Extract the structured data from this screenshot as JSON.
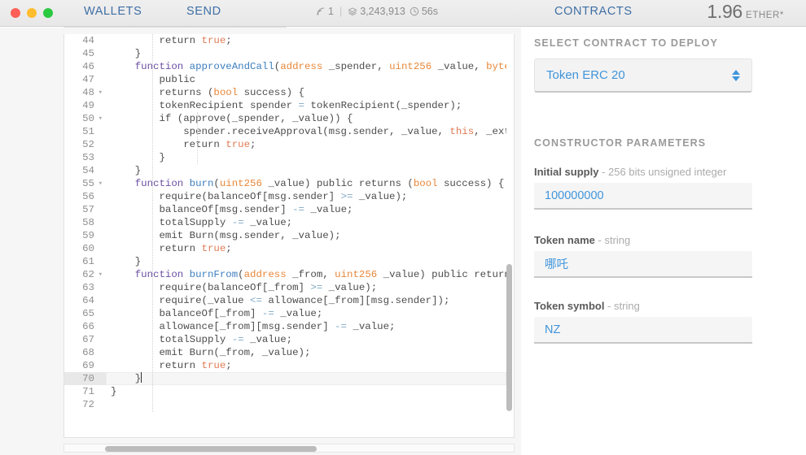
{
  "titlebar": {
    "window_controls": [
      "close",
      "minimize",
      "maximize"
    ],
    "nav": {
      "wallets": "WALLETS",
      "send": "SEND",
      "contracts": "CONTRACTS"
    },
    "status": {
      "peers_icon": "signal-icon",
      "peers": "1",
      "separator": "|",
      "block_icon": "blocks-icon",
      "block_number": "3,243,913",
      "time_icon": "clock-icon",
      "block_time": "56s"
    },
    "balance": {
      "value": "1.96",
      "unit": "ETHER*"
    }
  },
  "editor": {
    "active_line": 70,
    "lines": [
      {
        "n": "44",
        "fold": false,
        "tokens": [
          {
            "t": "        return ",
            "c": "pl"
          },
          {
            "t": "true",
            "c": "lit"
          },
          {
            "t": ";",
            "c": "pl"
          }
        ]
      },
      {
        "n": "45",
        "fold": false,
        "tokens": [
          {
            "t": "    }",
            "c": "pl"
          }
        ]
      },
      {
        "n": "46",
        "fold": false,
        "tokens": [
          {
            "t": "    ",
            "c": "pl"
          },
          {
            "t": "function ",
            "c": "kw"
          },
          {
            "t": "approveAndCall",
            "c": "fn"
          },
          {
            "t": "(",
            "c": "pl"
          },
          {
            "t": "address",
            "c": "typ"
          },
          {
            "t": " _spender, ",
            "c": "pl"
          },
          {
            "t": "uint256",
            "c": "typ"
          },
          {
            "t": " _value, ",
            "c": "pl"
          },
          {
            "t": "bytes",
            "c": "typ"
          },
          {
            "t": " _",
            "c": "pl"
          }
        ]
      },
      {
        "n": "47",
        "fold": false,
        "tokens": [
          {
            "t": "        public",
            "c": "pl"
          }
        ]
      },
      {
        "n": "48",
        "fold": true,
        "tokens": [
          {
            "t": "        returns (",
            "c": "pl"
          },
          {
            "t": "bool",
            "c": "typ"
          },
          {
            "t": " success) {",
            "c": "pl"
          }
        ]
      },
      {
        "n": "49",
        "fold": false,
        "tokens": [
          {
            "t": "        tokenRecipient spender ",
            "c": "pl"
          },
          {
            "t": "=",
            "c": "op"
          },
          {
            "t": " tokenRecipient(_spender);",
            "c": "pl"
          }
        ]
      },
      {
        "n": "50",
        "fold": true,
        "tokens": [
          {
            "t": "        if (approve(_spender, _value)) {",
            "c": "pl"
          }
        ]
      },
      {
        "n": "51",
        "fold": false,
        "tokens": [
          {
            "t": "            spender.receiveApproval(msg.sender, _value, ",
            "c": "pl"
          },
          {
            "t": "this",
            "c": "lit"
          },
          {
            "t": ", _extraI",
            "c": "pl"
          }
        ]
      },
      {
        "n": "52",
        "fold": false,
        "tokens": [
          {
            "t": "            return ",
            "c": "pl"
          },
          {
            "t": "true",
            "c": "lit"
          },
          {
            "t": ";",
            "c": "pl"
          }
        ]
      },
      {
        "n": "53",
        "fold": false,
        "tokens": [
          {
            "t": "        }",
            "c": "pl"
          }
        ]
      },
      {
        "n": "54",
        "fold": false,
        "tokens": [
          {
            "t": "    }",
            "c": "pl"
          }
        ]
      },
      {
        "n": "55",
        "fold": true,
        "tokens": [
          {
            "t": "    ",
            "c": "pl"
          },
          {
            "t": "function ",
            "c": "kw"
          },
          {
            "t": "burn",
            "c": "fn"
          },
          {
            "t": "(",
            "c": "pl"
          },
          {
            "t": "uint256",
            "c": "typ"
          },
          {
            "t": " _value) public returns (",
            "c": "pl"
          },
          {
            "t": "bool",
            "c": "typ"
          },
          {
            "t": " success) {",
            "c": "pl"
          }
        ]
      },
      {
        "n": "56",
        "fold": false,
        "tokens": [
          {
            "t": "        require(balanceOf[msg.sender] ",
            "c": "pl"
          },
          {
            "t": ">=",
            "c": "op"
          },
          {
            "t": " _value);",
            "c": "pl"
          }
        ]
      },
      {
        "n": "57",
        "fold": false,
        "tokens": [
          {
            "t": "        balanceOf[msg.sender] ",
            "c": "pl"
          },
          {
            "t": "-=",
            "c": "op"
          },
          {
            "t": " _value;",
            "c": "pl"
          }
        ]
      },
      {
        "n": "58",
        "fold": false,
        "tokens": [
          {
            "t": "        totalSupply ",
            "c": "pl"
          },
          {
            "t": "-=",
            "c": "op"
          },
          {
            "t": " _value;",
            "c": "pl"
          }
        ]
      },
      {
        "n": "59",
        "fold": false,
        "tokens": [
          {
            "t": "        emit Burn(msg.sender, _value);",
            "c": "pl"
          }
        ]
      },
      {
        "n": "60",
        "fold": false,
        "tokens": [
          {
            "t": "        return ",
            "c": "pl"
          },
          {
            "t": "true",
            "c": "lit"
          },
          {
            "t": ";",
            "c": "pl"
          }
        ]
      },
      {
        "n": "61",
        "fold": false,
        "tokens": [
          {
            "t": "    }",
            "c": "pl"
          }
        ]
      },
      {
        "n": "62",
        "fold": true,
        "tokens": [
          {
            "t": "    ",
            "c": "pl"
          },
          {
            "t": "function ",
            "c": "kw"
          },
          {
            "t": "burnFrom",
            "c": "fn"
          },
          {
            "t": "(",
            "c": "pl"
          },
          {
            "t": "address",
            "c": "typ"
          },
          {
            "t": " _from, ",
            "c": "pl"
          },
          {
            "t": "uint256",
            "c": "typ"
          },
          {
            "t": " _value) public returns (",
            "c": "pl"
          }
        ]
      },
      {
        "n": "63",
        "fold": false,
        "tokens": [
          {
            "t": "        require(balanceOf[_from] ",
            "c": "pl"
          },
          {
            "t": ">=",
            "c": "op"
          },
          {
            "t": " _value);",
            "c": "pl"
          }
        ]
      },
      {
        "n": "64",
        "fold": false,
        "tokens": [
          {
            "t": "        require(_value ",
            "c": "pl"
          },
          {
            "t": "<=",
            "c": "op"
          },
          {
            "t": " allowance[_from][msg.sender]);",
            "c": "pl"
          }
        ]
      },
      {
        "n": "65",
        "fold": false,
        "tokens": [
          {
            "t": "        balanceOf[_from] ",
            "c": "pl"
          },
          {
            "t": "-=",
            "c": "op"
          },
          {
            "t": " _value;",
            "c": "pl"
          }
        ]
      },
      {
        "n": "66",
        "fold": false,
        "tokens": [
          {
            "t": "        allowance[_from][msg.sender] ",
            "c": "pl"
          },
          {
            "t": "-=",
            "c": "op"
          },
          {
            "t": " _value;",
            "c": "pl"
          }
        ]
      },
      {
        "n": "67",
        "fold": false,
        "tokens": [
          {
            "t": "        totalSupply ",
            "c": "pl"
          },
          {
            "t": "-=",
            "c": "op"
          },
          {
            "t": " _value;",
            "c": "pl"
          }
        ]
      },
      {
        "n": "68",
        "fold": false,
        "tokens": [
          {
            "t": "        emit Burn(_from, _value);",
            "c": "pl"
          }
        ]
      },
      {
        "n": "69",
        "fold": false,
        "tokens": [
          {
            "t": "        return ",
            "c": "pl"
          },
          {
            "t": "true",
            "c": "lit"
          },
          {
            "t": ";",
            "c": "pl"
          }
        ]
      },
      {
        "n": "70",
        "fold": false,
        "tokens": [
          {
            "t": "    }",
            "c": "pl"
          }
        ]
      },
      {
        "n": "71",
        "fold": false,
        "tokens": [
          {
            "t": "}",
            "c": "pl"
          }
        ]
      },
      {
        "n": "72",
        "fold": false,
        "tokens": [
          {
            "t": "",
            "c": "pl"
          }
        ]
      }
    ]
  },
  "sidebar": {
    "select_heading": "SELECT CONTRACT TO DEPLOY",
    "selected_contract": "Token ERC 20",
    "params_heading": "CONSTRUCTOR PARAMETERS",
    "fields": [
      {
        "name": "Initial supply",
        "type": "- 256 bits unsigned integer",
        "value": "100000000"
      },
      {
        "name": "Token name",
        "type": "- string",
        "value": "哪吒"
      },
      {
        "name": "Token symbol",
        "type": "- string",
        "value": "NZ"
      }
    ]
  },
  "colors": {
    "accent_blue": "#3f95db",
    "nav_blue": "#3d6fa5",
    "keyword_purple": "#6b4fa3",
    "type_orange": "#e8883a",
    "literal_orange": "#e07b52"
  }
}
